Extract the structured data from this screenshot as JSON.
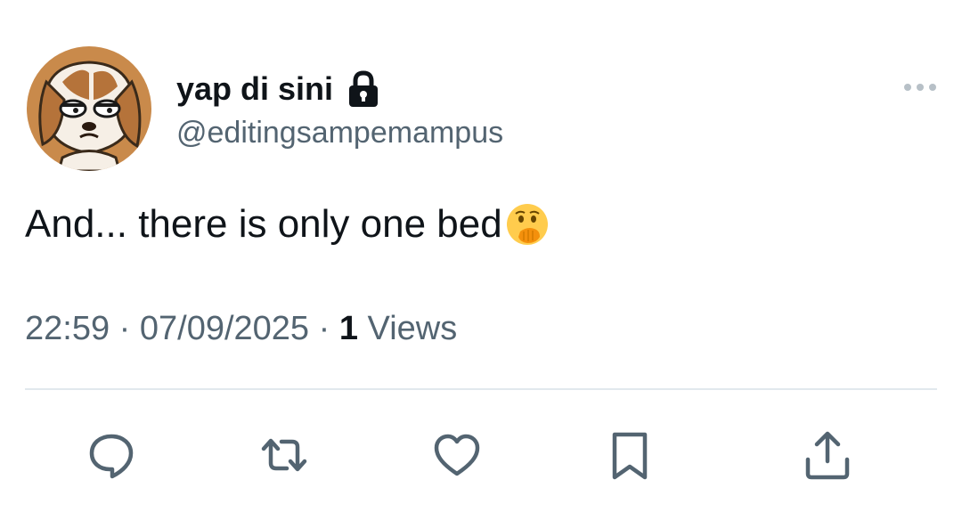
{
  "author": {
    "display_name": "yap di sini",
    "handle": "@editingsampemampus",
    "protected_icon": "lock-icon",
    "avatar_icon": "cartoon-dog-avatar"
  },
  "tweet": {
    "text": "And... there is only one bed",
    "emoji": "face-with-hand-over-mouth-emoji"
  },
  "meta": {
    "time": "22:59",
    "separator": "·",
    "date": "07/09/2025",
    "views_count": "1",
    "views_label": "Views"
  },
  "actions": [
    {
      "name": "reply",
      "icon": "reply-icon"
    },
    {
      "name": "retweet",
      "icon": "retweet-icon"
    },
    {
      "name": "like",
      "icon": "heart-icon"
    },
    {
      "name": "bookmark",
      "icon": "bookmark-icon"
    },
    {
      "name": "share",
      "icon": "share-icon"
    }
  ],
  "colors": {
    "primary_text": "#0f1419",
    "secondary_text": "#536471",
    "divider": "#e1e8ed",
    "icon": "#536471"
  }
}
